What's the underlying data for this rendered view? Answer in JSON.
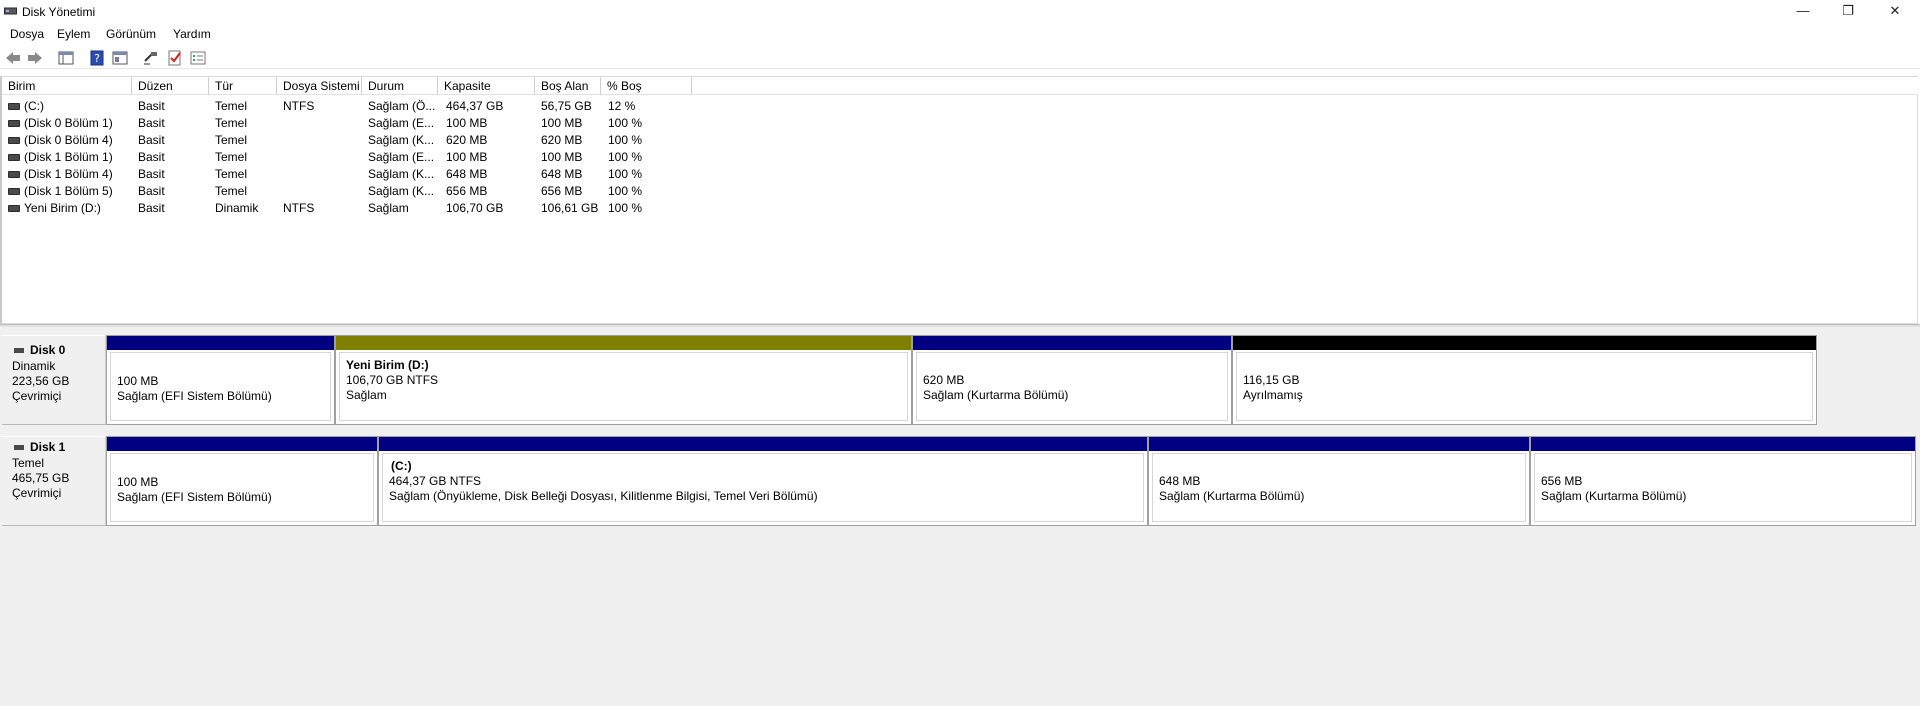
{
  "window": {
    "title": "Disk Yönetimi",
    "controls": {
      "minimize": "—",
      "restore": "❐",
      "close": "✕"
    }
  },
  "menu": [
    "Dosya",
    "Eylem",
    "Görünüm",
    "Yardım"
  ],
  "toolbar": {
    "icons": [
      "back-arrow-icon",
      "forward-arrow-icon",
      "console-tree-icon",
      "help-icon",
      "properties-icon",
      "connect-icon",
      "check-icon",
      "list-view-icon"
    ]
  },
  "volume_list": {
    "columns": [
      "Birim",
      "Düzen",
      "Tür",
      "Dosya Sistemi",
      "Durum",
      "Kapasite",
      "Boş Alan",
      "% Boş"
    ],
    "rows": [
      [
        "(C:)",
        "Basit",
        "Temel",
        "NTFS",
        "Sağlam (Ö...",
        "464,37 GB",
        "56,75 GB",
        "12 %"
      ],
      [
        "(Disk 0 Bölüm 1)",
        "Basit",
        "Temel",
        "",
        "Sağlam (E...",
        "100 MB",
        "100 MB",
        "100 %"
      ],
      [
        "(Disk 0 Bölüm 4)",
        "Basit",
        "Temel",
        "",
        "Sağlam (K...",
        "620 MB",
        "620 MB",
        "100 %"
      ],
      [
        "(Disk 1 Bölüm 1)",
        "Basit",
        "Temel",
        "",
        "Sağlam (E...",
        "100 MB",
        "100 MB",
        "100 %"
      ],
      [
        "(Disk 1 Bölüm 4)",
        "Basit",
        "Temel",
        "",
        "Sağlam (K...",
        "648 MB",
        "648 MB",
        "100 %"
      ],
      [
        "(Disk 1 Bölüm 5)",
        "Basit",
        "Temel",
        "",
        "Sağlam (K...",
        "656 MB",
        "656 MB",
        "100 %"
      ],
      [
        "Yeni Birim (D:)",
        "Basit",
        "Dinamik",
        "NTFS",
        "Sağlam",
        "106,70 GB",
        "106,61 GB",
        "100 %"
      ]
    ]
  },
  "disks": [
    {
      "name": "Disk 0",
      "type": "Dinamik",
      "size": "223,56 GB",
      "status": "Çevrimiçi",
      "partitions": [
        {
          "title": "",
          "line1": "100 MB",
          "line2": "Sağlam (EFI Sistem Bölümü)",
          "color": "#000080"
        },
        {
          "title": "Yeni Birim  (D:)",
          "line1": "106,70 GB NTFS",
          "line2": "Sağlam",
          "color": "#808000"
        },
        {
          "title": "",
          "line1": "620 MB",
          "line2": "Sağlam (Kurtarma Bölümü)",
          "color": "#000080"
        },
        {
          "title": "",
          "line1": "116,15 GB",
          "line2": "Ayrılmamış",
          "color": "#000000"
        }
      ]
    },
    {
      "name": "Disk 1",
      "type": "Temel",
      "size": "465,75 GB",
      "status": "Çevrimiçi",
      "partitions": [
        {
          "title": "",
          "line1": "100 MB",
          "line2": "Sağlam (EFI Sistem Bölümü)",
          "color": "#000080"
        },
        {
          "title": "(C:)",
          "line1": "464,37 GB NTFS",
          "line2": "Sağlam (Önyükleme, Disk Belleği Dosyası, Kilitlenme Bilgisi, Temel Veri Bölümü)",
          "color": "#000080"
        },
        {
          "title": "",
          "line1": "648 MB",
          "line2": "Sağlam (Kurtarma Bölümü)",
          "color": "#000080"
        },
        {
          "title": "",
          "line1": "656 MB",
          "line2": "Sağlam (Kurtarma Bölümü)",
          "color": "#000080"
        }
      ]
    }
  ]
}
